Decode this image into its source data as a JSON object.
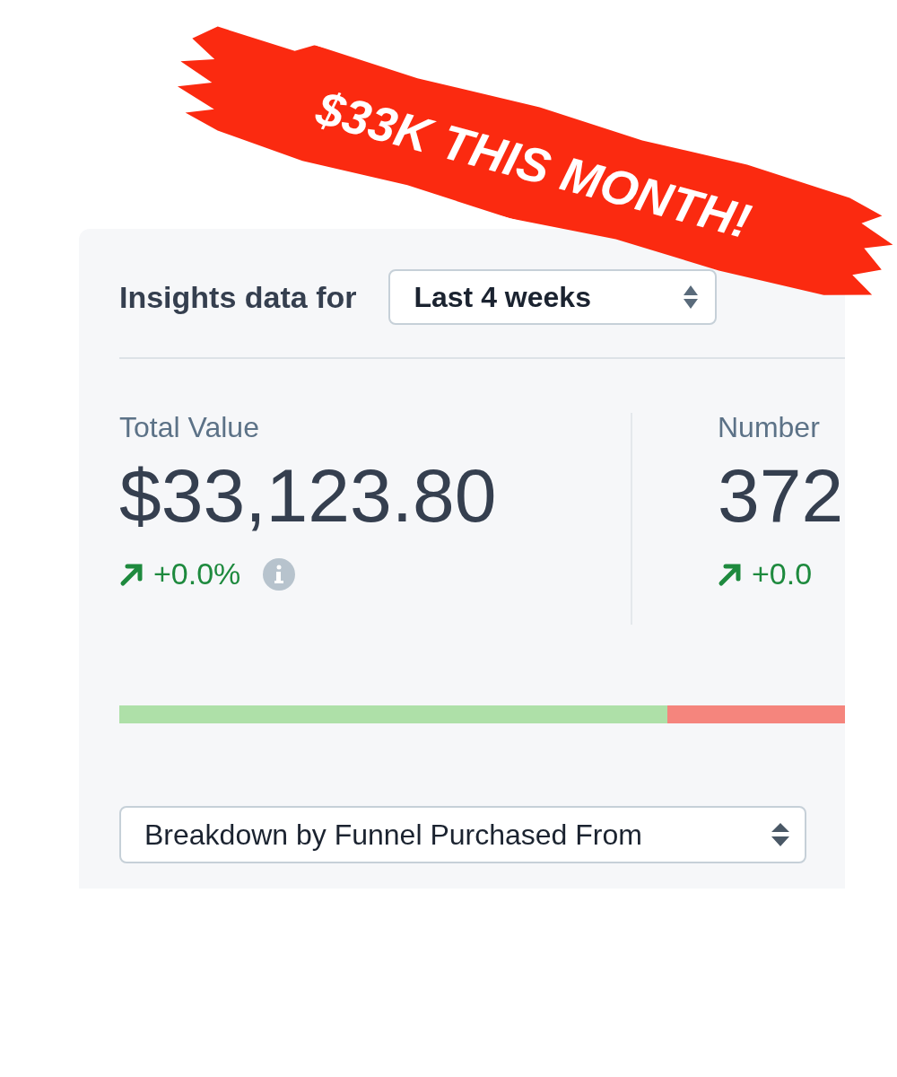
{
  "banner": {
    "text": "$33K THIS MONTH!"
  },
  "header": {
    "title": "Insights data for",
    "period_select": {
      "value": "Last 4 weeks"
    }
  },
  "stats": [
    {
      "label": "Total Value",
      "value": "$33,123.80",
      "change": "+0.0%",
      "info": true
    },
    {
      "label": "Number",
      "value": "372",
      "change": "+0.0"
    }
  ],
  "split_bar": {
    "level": 0.755
  },
  "breakdown_select": {
    "value": "Breakdown by Funnel Purchased From"
  }
}
